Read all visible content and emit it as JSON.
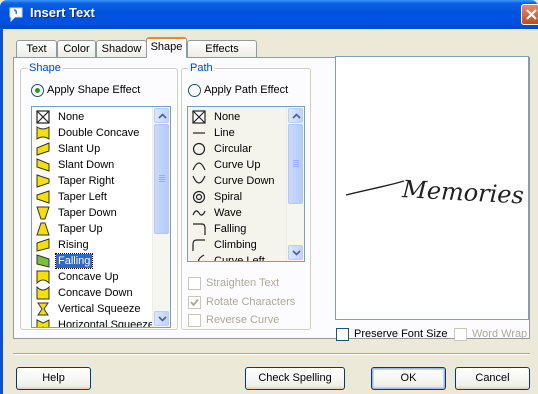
{
  "window": {
    "title": "Insert Text"
  },
  "tabs": [
    {
      "label": "Text"
    },
    {
      "label": "Color"
    },
    {
      "label": "Shadow"
    },
    {
      "label": "Shape"
    },
    {
      "label": "Effects Gallery"
    }
  ],
  "active_tab": "Shape",
  "shape_group": {
    "label": "Shape",
    "radio_label": "Apply Shape Effect",
    "radio_checked": true,
    "items": [
      {
        "label": "None",
        "icon": "none-box-icon"
      },
      {
        "label": "Double Concave",
        "icon": "double-concave-icon"
      },
      {
        "label": "Slant Up",
        "icon": "slant-up-icon"
      },
      {
        "label": "Slant Down",
        "icon": "slant-down-icon"
      },
      {
        "label": "Taper Right",
        "icon": "taper-right-icon"
      },
      {
        "label": "Taper Left",
        "icon": "taper-left-icon"
      },
      {
        "label": "Taper Down",
        "icon": "taper-down-icon"
      },
      {
        "label": "Taper Up",
        "icon": "taper-up-icon"
      },
      {
        "label": "Rising",
        "icon": "rising-icon"
      },
      {
        "label": "Falling",
        "icon": "falling-icon"
      },
      {
        "label": "Concave Up",
        "icon": "concave-up-icon"
      },
      {
        "label": "Concave Down",
        "icon": "concave-down-icon"
      },
      {
        "label": "Vertical Squeeze",
        "icon": "vertical-squeeze-icon"
      },
      {
        "label": "Horizontal Squeeze",
        "icon": "horizontal-squeeze-icon"
      }
    ],
    "selected": "Falling",
    "shape_icon_color": "#f5e100"
  },
  "path_group": {
    "label": "Path",
    "radio_label": "Apply Path Effect",
    "radio_checked": false,
    "items": [
      {
        "label": "None",
        "icon": "none-box-icon"
      },
      {
        "label": "Line",
        "icon": "line-path-icon"
      },
      {
        "label": "Circular",
        "icon": "circular-path-icon"
      },
      {
        "label": "Curve Up",
        "icon": "curve-up-path-icon"
      },
      {
        "label": "Curve Down",
        "icon": "curve-down-path-icon"
      },
      {
        "label": "Spiral",
        "icon": "spiral-path-icon"
      },
      {
        "label": "Wave",
        "icon": "wave-path-icon"
      },
      {
        "label": "Falling",
        "icon": "falling-path-icon"
      },
      {
        "label": "Climbing",
        "icon": "climbing-path-icon"
      },
      {
        "label": "Curve Left",
        "icon": "curve-left-path-icon"
      }
    ],
    "straighten_text": {
      "label": "Straighten Text",
      "checked": false,
      "enabled": false
    },
    "rotate_characters": {
      "label": "Rotate Characters",
      "checked": true,
      "enabled": false
    },
    "reverse_curve": {
      "label": "Reverse Curve",
      "checked": false,
      "enabled": false
    }
  },
  "preview": {
    "text": "Memories"
  },
  "options": {
    "preserve_font_size": {
      "label": "Preserve Font Size",
      "checked": false,
      "enabled": true
    },
    "word_wrap": {
      "label": "Word Wrap",
      "checked": false,
      "enabled": false
    }
  },
  "buttons": {
    "help": "Help",
    "check_spelling": "Check Spelling",
    "ok": "OK",
    "cancel": "Cancel"
  },
  "colors": {
    "titlebar": "#0053df",
    "selection": "#316ac5",
    "group_label": "#0046d5",
    "dialog_bg": "#ece9d8"
  }
}
